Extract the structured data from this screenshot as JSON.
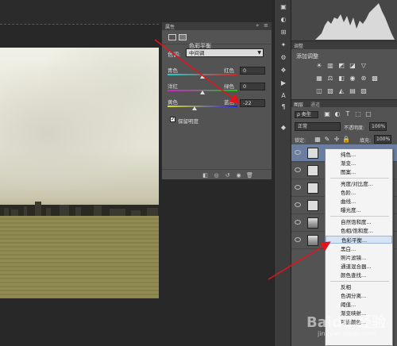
{
  "properties_panel": {
    "tab_label": "属性",
    "adjustment_name": "色彩平衡",
    "tone_label": "色调:",
    "tone_value": "中间调",
    "sliders": [
      {
        "left": "青色",
        "right": "红色",
        "value": "0",
        "level": 0
      },
      {
        "left": "洋红",
        "right": "绿色",
        "value": "0",
        "level": 0
      },
      {
        "left": "黄色",
        "right": "蓝色",
        "value": "-22",
        "level": -22
      }
    ],
    "preserve_luminosity": "保留明度"
  },
  "adjustments_panel": {
    "tab_label": "调整",
    "add_label": "添加调整"
  },
  "layers_panel": {
    "tab_layers": "图层",
    "tab_channels": "通道",
    "kind_label": "ρ 类型",
    "blend_mode": "正常",
    "opacity_label": "不透明度:",
    "opacity_value": "100%",
    "lock_label": "锁定:",
    "fill_label": "填充:",
    "fill_value": "100%"
  },
  "context_menu": {
    "items": [
      "纯色...",
      "渐变...",
      "图案...",
      "亮度/对比度...",
      "色阶...",
      "曲线...",
      "曝光度...",
      "自然饱和度...",
      "色相/饱和度...",
      "色彩平衡...",
      "黑白...",
      "照片滤镜...",
      "通道混合器...",
      "颜色查找...",
      "反相",
      "色调分离...",
      "阈值...",
      "渐变映射...",
      "可选颜色..."
    ],
    "highlighted": "色彩平衡..."
  },
  "watermark": {
    "logo": "Baidu 经验",
    "url": "jingyan.baidu.com"
  },
  "colors": {
    "arrow": "#e0141e",
    "menu_highlight": "#d6e4f5"
  }
}
